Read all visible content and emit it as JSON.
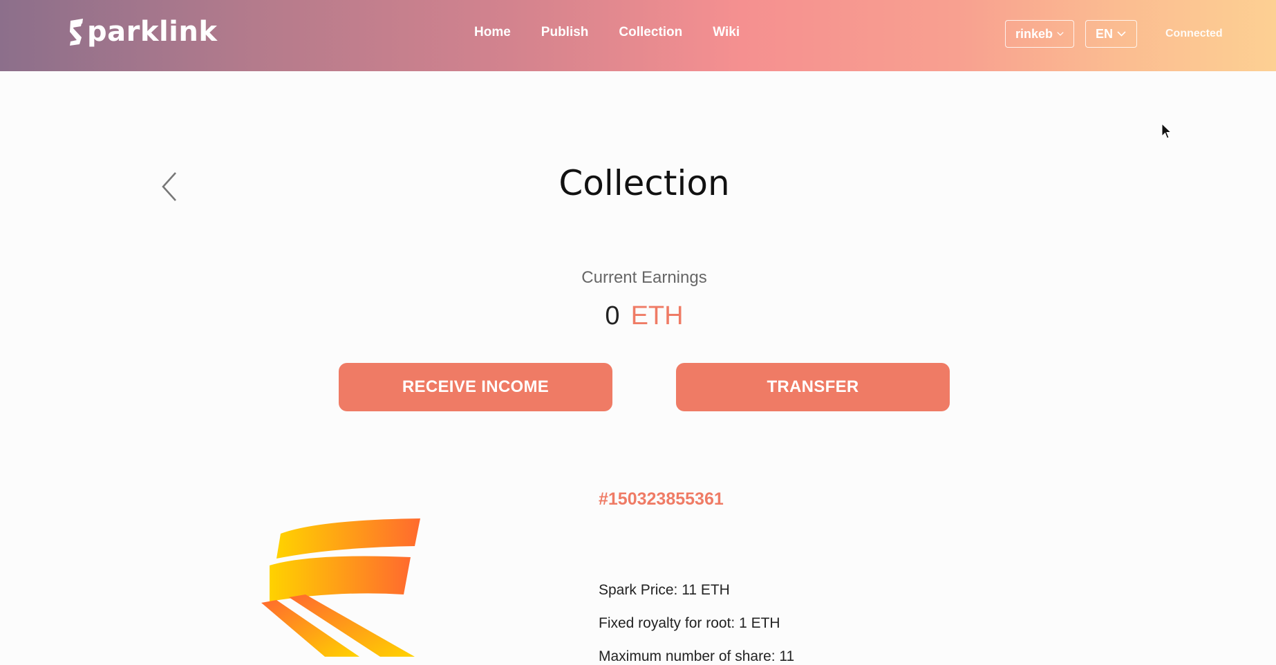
{
  "header": {
    "brand": "parklink",
    "nav": [
      "Home",
      "Publish",
      "Collection",
      "Wiki"
    ],
    "network_select": "rinkeb",
    "language_select": "EN",
    "status": "Connected"
  },
  "page": {
    "title": "Collection",
    "earnings_label": "Current Earnings",
    "earnings_value": "0",
    "earnings_unit": "ETH",
    "receive_button": "RECEIVE INCOME",
    "transfer_button": "TRANSFER"
  },
  "item": {
    "token_id": "#150323855361",
    "details": [
      "Spark Price: 11 ETH",
      "Fixed royalty for root: 1 ETH",
      "Maximum number of share: 11"
    ]
  },
  "colors": {
    "accent": "#ef7b65",
    "header_gradient": [
      "#8c6f8b",
      "#f59090",
      "#fdd093"
    ]
  },
  "icons": {
    "logo": "sparklink-s-logo",
    "back": "chevron-left-icon",
    "dropdown": "chevron-down-icon",
    "cursor": "mouse-pointer-icon"
  }
}
